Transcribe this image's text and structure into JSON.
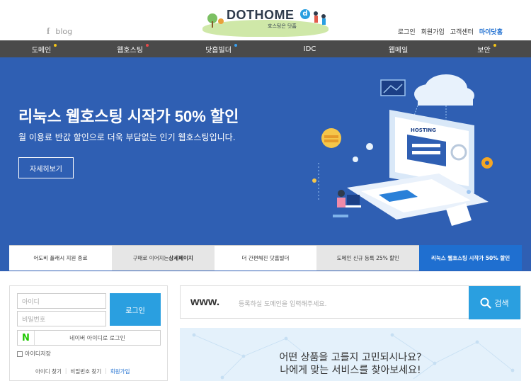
{
  "header": {
    "social_blog": "blog",
    "logo_text": "DOTHOME",
    "logo_badge": "d",
    "logo_sub": "호스팅은 닷홈",
    "util_links": [
      "로그인",
      "회원가입",
      "고객센터",
      "마이닷홈"
    ]
  },
  "nav": {
    "items": [
      {
        "label": "도메인",
        "dot": "#f5c518"
      },
      {
        "label": "웹호스팅",
        "dot": "#e84a4a"
      },
      {
        "label": "닷홈빌더",
        "dot": "#3aa0f0"
      },
      {
        "label": "IDC",
        "dot": ""
      },
      {
        "label": "웹메일",
        "dot": ""
      },
      {
        "label": "보안",
        "dot": "#f5c518"
      }
    ]
  },
  "hero": {
    "title": "리눅스 웹호스팅 시작가 50% 할인",
    "subtitle": "월 이용료 반값 할인으로 더욱 부담없는 인기 웹호스팅입니다.",
    "button": "자세히보기",
    "screen_label": "HOSTING"
  },
  "tabs": [
    {
      "pre": "어도비 플래시 지원 종료",
      "bold": "",
      "post": ""
    },
    {
      "pre": "구매로 이어지는 ",
      "bold": "상세페이지",
      "post": ""
    },
    {
      "pre": "더 간편해진 닷홈빌더",
      "bold": "",
      "post": ""
    },
    {
      "pre": "도메인 신규 등록 25% 할인",
      "bold": "",
      "post": ""
    },
    {
      "pre": "리눅스 웹호스팅 시작가 50% 할인",
      "bold": "",
      "post": ""
    }
  ],
  "login": {
    "id_placeholder": "아이디",
    "pw_placeholder": "비밀번호",
    "login_button": "로그인",
    "naver_letter": "N",
    "naver_label": "네이버 아이디로 로그인",
    "save_id": "아이디저장",
    "find_id": "아이디 찾기",
    "find_pw": "비밀번호 찾기",
    "join": "회원가입"
  },
  "domain_search": {
    "prefix": "www.",
    "placeholder": "등록하실 도메인을 입력해주세요.",
    "button": "검색"
  },
  "promo": {
    "line1": "어떤 상품을 고를지 고민되시나요?",
    "line2": "나에게 맞는 서비스를 찾아보세요!"
  },
  "colors": {
    "nav_bg": "#4a4a4a",
    "hero_bg": "#2f5fb3",
    "accent": "#2a9fe0",
    "tab_active": "#1f6fd0"
  }
}
